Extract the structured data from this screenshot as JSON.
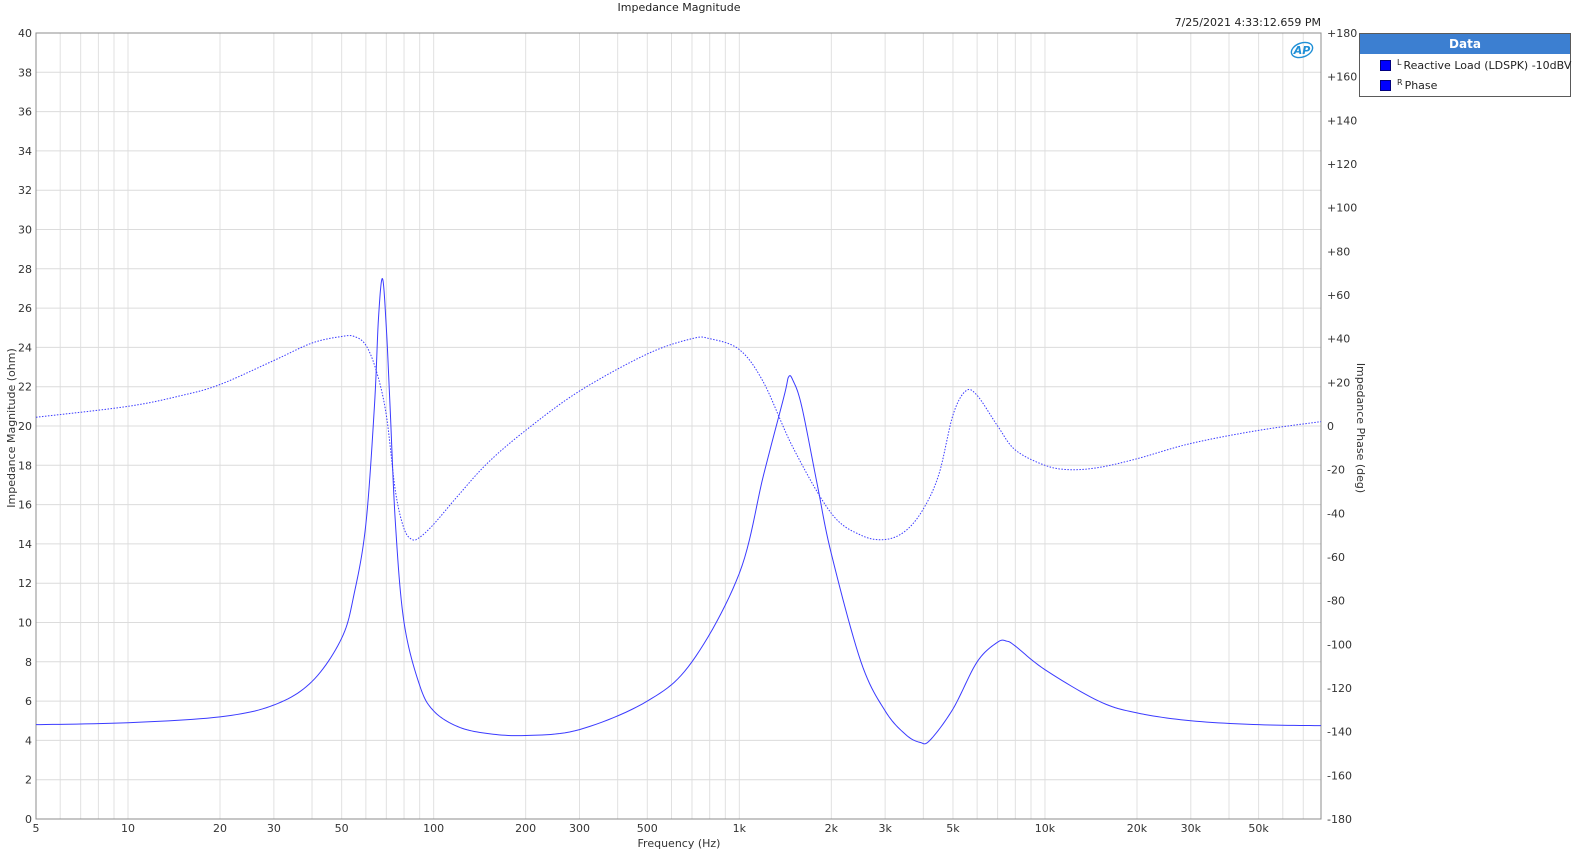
{
  "chart_data": {
    "type": "line",
    "title": "Impedance Magnitude",
    "timestamp": "7/25/2021 4:33:12.659 PM",
    "xlabel": "Frequency (Hz)",
    "ylabel": "Impedance Magnitude (ohm)",
    "y2label": "Impedance Phase (deg)",
    "xscale": "log",
    "xlim": [
      5,
      80000
    ],
    "ylim": [
      0,
      40
    ],
    "y2lim": [
      -180,
      180
    ],
    "grid": true,
    "legend_position": "top-right outside",
    "x_ticks": [
      5,
      10,
      20,
      30,
      50,
      100,
      200,
      300,
      500,
      1000,
      2000,
      3000,
      5000,
      10000,
      20000,
      30000,
      50000
    ],
    "x_tick_labels": [
      "5",
      "10",
      "20",
      "30",
      "50",
      "100",
      "200",
      "300",
      "500",
      "1k",
      "2k",
      "3k",
      "5k",
      "10k",
      "20k",
      "30k",
      "50k"
    ],
    "y_ticks": [
      0,
      2,
      4,
      6,
      8,
      10,
      12,
      14,
      16,
      18,
      20,
      22,
      24,
      26,
      28,
      30,
      32,
      34,
      36,
      38,
      40
    ],
    "y2_ticks": [
      180,
      160,
      140,
      120,
      100,
      80,
      60,
      40,
      20,
      0,
      -20,
      -40,
      -60,
      -80,
      -100,
      -120,
      -140,
      -160,
      -180
    ],
    "y2_tick_labels": [
      "+180",
      "+160",
      "+140",
      "+120",
      "+100",
      "+80",
      "+60",
      "+40",
      "+20",
      "0",
      "-20",
      "-40",
      "-60",
      "-80",
      "-100",
      "-120",
      "-140",
      "-160",
      "-180"
    ],
    "series": [
      {
        "name": "Reactive Load (LDSPK) -10dBV",
        "channel": "L",
        "axis": "left",
        "style": "solid",
        "color": "#3b3bff",
        "x": [
          5,
          10,
          20,
          30,
          40,
          50,
          55,
          60,
          64,
          66,
          68,
          70,
          72,
          75,
          80,
          90,
          100,
          120,
          150,
          200,
          300,
          500,
          700,
          1000,
          1200,
          1400,
          1450,
          1500,
          1600,
          1800,
          2000,
          2500,
          3000,
          3500,
          3900,
          4200,
          5000,
          6000,
          7000,
          7500,
          8000,
          10000,
          15000,
          20000,
          30000,
          50000,
          80000
        ],
        "y": [
          4.8,
          4.9,
          5.2,
          5.8,
          7.0,
          9.2,
          11.5,
          15.0,
          21.0,
          25.5,
          27.5,
          25.0,
          21.0,
          15.0,
          10.0,
          6.8,
          5.5,
          4.7,
          4.35,
          4.25,
          4.55,
          6.0,
          8.0,
          12.5,
          17.5,
          21.5,
          22.5,
          22.3,
          21.0,
          17.0,
          13.5,
          8.0,
          5.5,
          4.3,
          3.9,
          4.0,
          5.6,
          8.0,
          9.0,
          9.05,
          8.8,
          7.6,
          6.0,
          5.4,
          5.0,
          4.8,
          4.75
        ]
      },
      {
        "name": "Phase",
        "channel": "R",
        "axis": "right",
        "style": "dotted",
        "color": "#3b3bff",
        "x": [
          5,
          10,
          15,
          20,
          30,
          40,
          50,
          55,
          60,
          65,
          70,
          75,
          80,
          85,
          90,
          100,
          120,
          150,
          200,
          300,
          500,
          700,
          800,
          1000,
          1200,
          1500,
          2000,
          2500,
          3000,
          3500,
          4000,
          4500,
          5000,
          5500,
          6000,
          7000,
          8000,
          10000,
          12000,
          15000,
          20000,
          30000,
          50000,
          80000
        ],
        "y": [
          4,
          9,
          14,
          19,
          30,
          38,
          41,
          41,
          37,
          25,
          5,
          -30,
          -47,
          -52,
          -51,
          -45,
          -32,
          -17,
          -2,
          16,
          33,
          40,
          40,
          35,
          20,
          -10,
          -40,
          -50,
          -52,
          -48,
          -38,
          -22,
          5,
          16,
          14,
          0,
          -11,
          -18,
          -20,
          -19,
          -15,
          -8,
          -2,
          2
        ]
      }
    ]
  },
  "legend": {
    "header": "Data",
    "items": [
      {
        "channel": "L",
        "label": "Reactive Load (LDSPK) -10dBV",
        "color": "#0000ff"
      },
      {
        "channel": "R",
        "label": "Phase",
        "color": "#0000ff"
      }
    ]
  },
  "logo": {
    "text": "AP",
    "color": "#1f8fd6"
  }
}
